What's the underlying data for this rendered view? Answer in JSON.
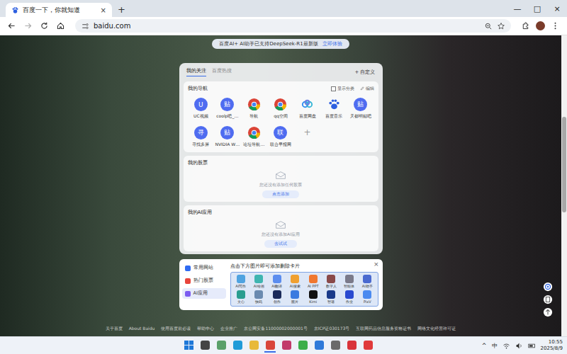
{
  "browser": {
    "tab": {
      "title": "百度一下，你就知道",
      "close": "×",
      "selected": true
    },
    "new_tab": "+",
    "controls": [
      "—",
      "□",
      "×"
    ],
    "address": "baidu.com"
  },
  "banner": {
    "text": "百度AI+ AI助手已支持DeepSeek-R1最新版",
    "link": "立即体验"
  },
  "card": {
    "tabs": [
      {
        "label": "我的关注",
        "selected": true
      },
      {
        "label": "百度热搜",
        "selected": false
      }
    ],
    "customize": "+ 自定义",
    "nav": {
      "title": "我的导航",
      "option": {
        "label": "显示分类",
        "checked": false
      },
      "edit": "编辑",
      "add": "+",
      "items": [
        {
          "label": "UC视频",
          "kind": "letter",
          "glyph": "U"
        },
        {
          "label": "coolp吧_…",
          "kind": "letter",
          "glyph": "贴"
        },
        {
          "label": "导航",
          "kind": "chrome"
        },
        {
          "label": "qq空间",
          "kind": "chrome"
        },
        {
          "label": "百度网盘",
          "kind": "cloud"
        },
        {
          "label": "百度音乐",
          "kind": "paw"
        },
        {
          "label": "天都明贴吧",
          "kind": "letter",
          "glyph": "贴"
        },
        {
          "label": "寻找多屏",
          "kind": "letter",
          "glyph": "寻"
        },
        {
          "label": "NVIDIA W…",
          "kind": "letter",
          "glyph": "贴"
        },
        {
          "label": "论坛导航…",
          "kind": "chrome"
        },
        {
          "label": "联合早报网",
          "kind": "letter",
          "glyph": "联"
        }
      ]
    },
    "sections": [
      {
        "title": "我的股票",
        "empty": "您还没有添加任何股票",
        "action": "点击添加"
      },
      {
        "title": "我的AI应用",
        "empty": "您还没有添加AI应用",
        "action": "去试试"
      }
    ]
  },
  "popup": {
    "menu": [
      {
        "label": "常用网站",
        "selected": false,
        "color": "#2f6bf2"
      },
      {
        "label": "热门股票",
        "selected": false,
        "color": "#e8453c"
      },
      {
        "label": "AI应用",
        "selected": true,
        "color": "#7b5cf0"
      }
    ],
    "title": "点击下方图片即可添加删除卡片",
    "close": "×",
    "cards": [
      {
        "label": "AI写作",
        "color": "#4fa3e0"
      },
      {
        "label": "AI绘画",
        "color": "#3fb5b0"
      },
      {
        "label": "AI翻译",
        "color": "#5b8def"
      },
      {
        "label": "AI搜索",
        "color": "#f0a030"
      },
      {
        "label": "AI PPT",
        "color": "#f07830"
      },
      {
        "label": "数字人",
        "color": "#8a4a4a"
      },
      {
        "label": "智能体",
        "color": "#7a7a8a"
      },
      {
        "label": "AI助手",
        "color": "#4a6ad0"
      },
      {
        "label": "文心",
        "color": "#2a9d8f"
      },
      {
        "label": "快码",
        "color": "#6a8ab0"
      },
      {
        "label": "创作",
        "color": "#1a2a5a"
      },
      {
        "label": "图片",
        "color": "#3a7ae0"
      },
      {
        "label": "Kimi",
        "color": "#111111"
      },
      {
        "label": "智谱",
        "color": "#1a3a8a"
      },
      {
        "label": "作业",
        "color": "#2a4ad0"
      },
      {
        "label": "PixV",
        "color": "#4a8af0"
      }
    ]
  },
  "footer": [
    "关于百度",
    "About Baidu",
    "使用百度前必读",
    "帮助中心",
    "企业推广",
    "京公网安备11000002000001号",
    "京ICP证030173号",
    "互联网药品信息服务资格证书",
    "网络文化经营许可证"
  ],
  "taskbar": {
    "apps": [
      {
        "kind": "start",
        "color": "#1e78d8",
        "selected": false
      },
      {
        "kind": "tile",
        "color": "#444444",
        "selected": false
      },
      {
        "kind": "tile",
        "color": "#5aa06a",
        "selected": false
      },
      {
        "kind": "tile",
        "color": "#1f9bd8",
        "selected": false
      },
      {
        "kind": "tile",
        "color": "#e8b93a",
        "selected": false
      },
      {
        "kind": "tile",
        "color": "#d9463a",
        "selected": true
      },
      {
        "kind": "tile",
        "color": "#c23a6a",
        "selected": false
      },
      {
        "kind": "tile",
        "color": "#3cae4a",
        "selected": false
      },
      {
        "kind": "tile",
        "color": "#2f7ad9",
        "selected": false
      },
      {
        "kind": "tile",
        "color": "#6a6a6a",
        "selected": false
      },
      {
        "kind": "tile",
        "color": "#d9343a",
        "selected": false
      },
      {
        "kind": "tile",
        "color": "#e03a3a",
        "selected": false
      }
    ],
    "tray": {
      "chevron": "^",
      "ime": "中",
      "time": "10:55",
      "date": "2025/8/9"
    }
  }
}
